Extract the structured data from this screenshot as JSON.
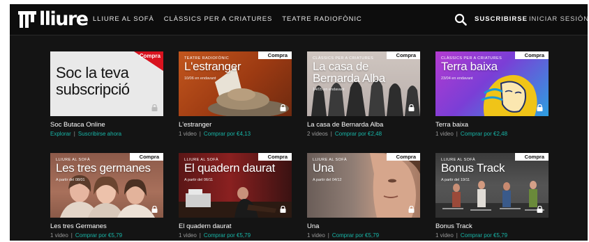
{
  "header": {
    "logo": "lliure",
    "nav": [
      "LLIURE AL SOFÀ",
      "CLÀSSICS PER A CRIATURES",
      "TEATRE RADIOFÒNIC"
    ],
    "subscribe": "SUSCRIBIRSE",
    "login": "INICIAR SESIÓN"
  },
  "cards": [
    {
      "badge": "Compra",
      "category": "",
      "title": "Soc la teva subscripció",
      "date": "",
      "name": "Soc Butaca Online",
      "meta_text": "",
      "link1": "Explorar",
      "link2": "Suscribirse ahora"
    },
    {
      "badge": "Compra",
      "category": "TEATRE RADIOFÒNIC",
      "title": "L'estranger",
      "date": "10/06 en endavant",
      "name": "L'estranger",
      "meta_text": "1 video",
      "link1": "",
      "link2": "Comprar por €4,13"
    },
    {
      "badge": "Compra",
      "category": "CLÀSSICS PER A CRIATURES",
      "title": "La casa de Bernarda Alba",
      "date": "14/05 en endavant",
      "name": "La casa de Bernarda Alba",
      "meta_text": "2 videos",
      "link1": "",
      "link2": "Comprar por €2,48"
    },
    {
      "badge": "Compra",
      "category": "CLÀSSICS PER A CRIATURES",
      "title": "Terra baixa",
      "date": "23/04 en endavant",
      "name": "Terra baixa",
      "meta_text": "1 video",
      "link1": "",
      "link2": "Comprar por €2,48"
    },
    {
      "badge": "Compra",
      "category": "LLIURE AL SOFÀ",
      "title": "Les tres germanes",
      "date": "A partir del 08/01",
      "name": "Les tres Germanes",
      "meta_text": "1 video",
      "link1": "",
      "link2": "Comprar por €5,79"
    },
    {
      "badge": "Compra",
      "category": "LLIURE AL SOFÀ",
      "title": "El quadern daurat",
      "date": "A partir del 06/11",
      "name": "El quadern daurat",
      "meta_text": "1 video",
      "link1": "",
      "link2": "Comprar por €5,79"
    },
    {
      "badge": "Compra",
      "category": "LLIURE AL SOFÀ",
      "title": "Una",
      "date": "A partir del 04/12",
      "name": "Una",
      "meta_text": "1 video",
      "link1": "",
      "link2": "Comprar por €5,79"
    },
    {
      "badge": "Compra",
      "category": "LLIURE AL SOFÀ",
      "title": "Bonus Track",
      "date": "A partir del 19/11",
      "name": "Bonus Track",
      "meta_text": "1 video",
      "link1": "",
      "link2": "Comprar por €5,79"
    }
  ]
}
